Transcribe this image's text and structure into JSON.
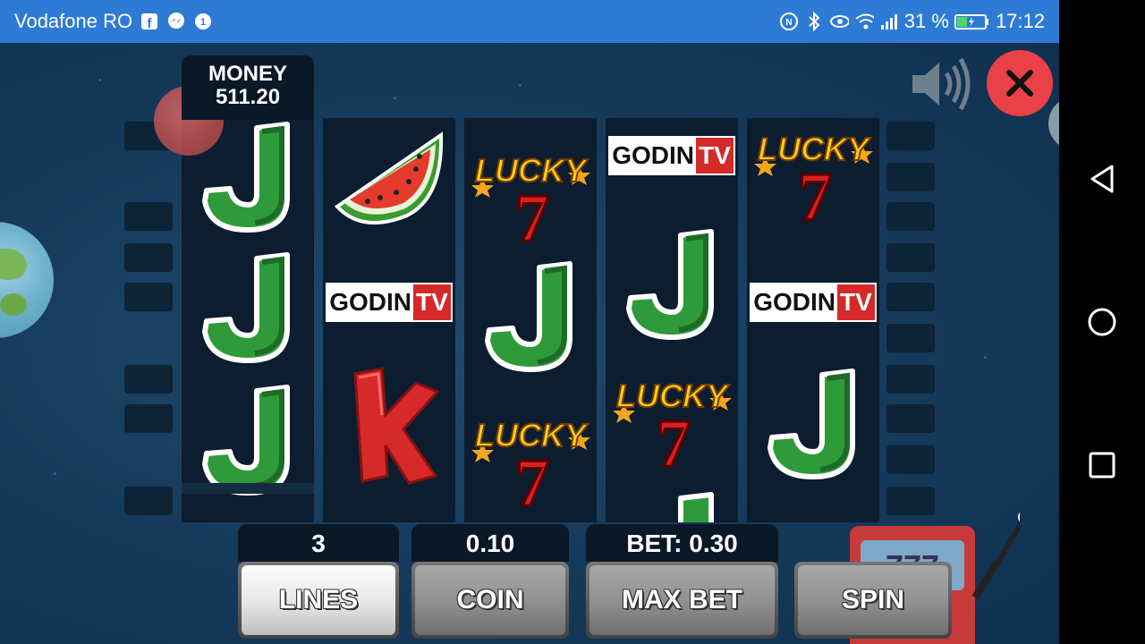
{
  "status_bar": {
    "carrier": "Vodafone RO",
    "battery": "31 %",
    "time": "17:12",
    "icons": [
      "facebook-icon",
      "messenger-icon",
      "data-saver-icon",
      "nfc-icon",
      "bluetooth-icon",
      "eye-icon",
      "wifi-icon",
      "signal-icon",
      "battery-icon"
    ]
  },
  "hud": {
    "money_label": "MONEY",
    "money_value": "511.20"
  },
  "reels": [
    [
      "J",
      "J",
      "J"
    ],
    [
      "watermelon",
      "GODINTV",
      "K"
    ],
    [
      "LUCKY7",
      "J",
      "LUCKY7"
    ],
    [
      "GODINTV",
      "J",
      "LUCKY7",
      "J"
    ],
    [
      "LUCKY7",
      "GODINTV",
      "J"
    ]
  ],
  "symbols": {
    "godin_text": "GODIN",
    "tv_text": "TV",
    "lucky_text": "LUCKY",
    "seven_text": "7",
    "j_text": "J",
    "k_text": "K"
  },
  "controls": {
    "lines_value": "3",
    "lines_label": "LINES",
    "coin_value": "0.10",
    "coin_label": "COIN",
    "bet_value": "BET: 0.30",
    "maxbet_label": "MAX BET",
    "spin_label": "SPIN"
  },
  "colors": {
    "status_bar": "#2e7bd6",
    "background": "#173b5c",
    "close_button": "#e94147",
    "j_green": "#2f9a3a",
    "k_red": "#d62a2a",
    "lucky_yellow": "#f5d21a",
    "seven_red": "#d82020"
  }
}
